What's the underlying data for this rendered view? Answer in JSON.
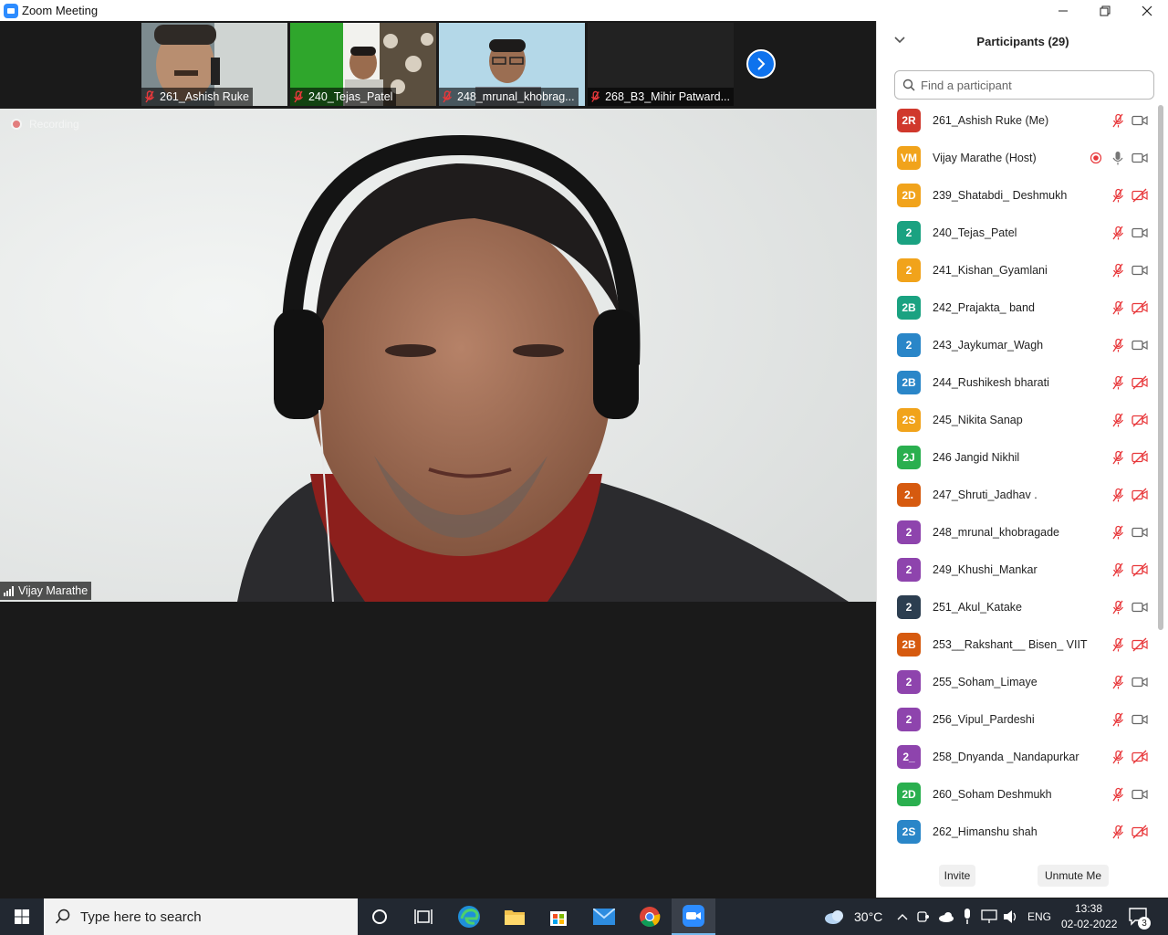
{
  "window": {
    "title": "Zoom Meeting"
  },
  "thumbnails": [
    {
      "name": "261_Ashish Ruke"
    },
    {
      "name": "240_Tejas_Patel"
    },
    {
      "name": "248_mrunal_khobrag..."
    },
    {
      "name": "268_B3_Mihir Patward..."
    }
  ],
  "main_video": {
    "recording_label": "Recording",
    "speaker_name": "Vijay Marathe"
  },
  "panel": {
    "title": "Participants (29)",
    "search_placeholder": "Find a participant",
    "invite_label": "Invite",
    "unmute_label": "Unmute Me",
    "participants": [
      {
        "initials": "2R",
        "name": "261_Ashish Ruke (Me)",
        "color": "#d0382c",
        "cam": "on",
        "rec": false,
        "mic": "muted"
      },
      {
        "initials": "VM",
        "name": "Vijay Marathe (Host)",
        "color": "#f1a31b",
        "cam": "on",
        "rec": true,
        "mic": "on"
      },
      {
        "initials": "2D",
        "name": "239_Shatabdi_ Deshmukh",
        "color": "#f1a31b",
        "cam": "off",
        "rec": false,
        "mic": "muted"
      },
      {
        "initials": "2",
        "name": "240_Tejas_Patel",
        "color": "#1aa281",
        "cam": "on",
        "rec": false,
        "mic": "muted"
      },
      {
        "initials": "2",
        "name": "241_Kishan_Gyamlani",
        "color": "#f1a31b",
        "cam": "on",
        "rec": false,
        "mic": "muted"
      },
      {
        "initials": "2B",
        "name": "242_Prajakta_ band",
        "color": "#1aa281",
        "cam": "off",
        "rec": false,
        "mic": "muted"
      },
      {
        "initials": "2",
        "name": "243_Jaykumar_Wagh",
        "color": "#2a86c8",
        "cam": "on",
        "rec": false,
        "mic": "muted"
      },
      {
        "initials": "2B",
        "name": "244_Rushikesh bharati",
        "color": "#2a86c8",
        "cam": "off",
        "rec": false,
        "mic": "muted"
      },
      {
        "initials": "2S",
        "name": "245_Nikita Sanap",
        "color": "#f1a31b",
        "cam": "off",
        "rec": false,
        "mic": "muted"
      },
      {
        "initials": "2J",
        "name": "246 Jangid Nikhil",
        "color": "#2aaf4f",
        "cam": "off",
        "rec": false,
        "mic": "muted"
      },
      {
        "initials": "2.",
        "name": "247_Shruti_Jadhav .",
        "color": "#d65a0f",
        "cam": "off",
        "rec": false,
        "mic": "muted"
      },
      {
        "initials": "2",
        "name": "248_mrunal_khobragade",
        "color": "#8e44ad",
        "cam": "on",
        "rec": false,
        "mic": "muted"
      },
      {
        "initials": "2",
        "name": "249_Khushi_Mankar",
        "color": "#8e44ad",
        "cam": "off",
        "rec": false,
        "mic": "muted"
      },
      {
        "initials": "2",
        "name": "251_Akul_Katake",
        "color": "#2c3e50",
        "cam": "on",
        "rec": false,
        "mic": "muted"
      },
      {
        "initials": "2B",
        "name": "253__Rakshant__ Bisen_ VIIT",
        "color": "#d65a0f",
        "cam": "off",
        "rec": false,
        "mic": "muted"
      },
      {
        "initials": "2",
        "name": "255_Soham_Limaye",
        "color": "#8e44ad",
        "cam": "on",
        "rec": false,
        "mic": "muted"
      },
      {
        "initials": "2",
        "name": "256_Vipul_Pardeshi",
        "color": "#8e44ad",
        "cam": "on",
        "rec": false,
        "mic": "muted"
      },
      {
        "initials": "2_",
        "name": "258_Dnyanda _Nandapurkar",
        "color": "#8e44ad",
        "cam": "off",
        "rec": false,
        "mic": "muted"
      },
      {
        "initials": "2D",
        "name": "260_Soham Deshmukh",
        "color": "#2aaf4f",
        "cam": "on",
        "rec": false,
        "mic": "muted"
      },
      {
        "initials": "2S",
        "name": "262_Himanshu shah",
        "color": "#2a86c8",
        "cam": "off",
        "rec": false,
        "mic": "muted"
      }
    ]
  },
  "taskbar": {
    "search_placeholder": "Type here to search",
    "weather": "30°C",
    "language": "ENG",
    "time": "13:38",
    "date": "02-02-2022",
    "notification_count": "3"
  }
}
